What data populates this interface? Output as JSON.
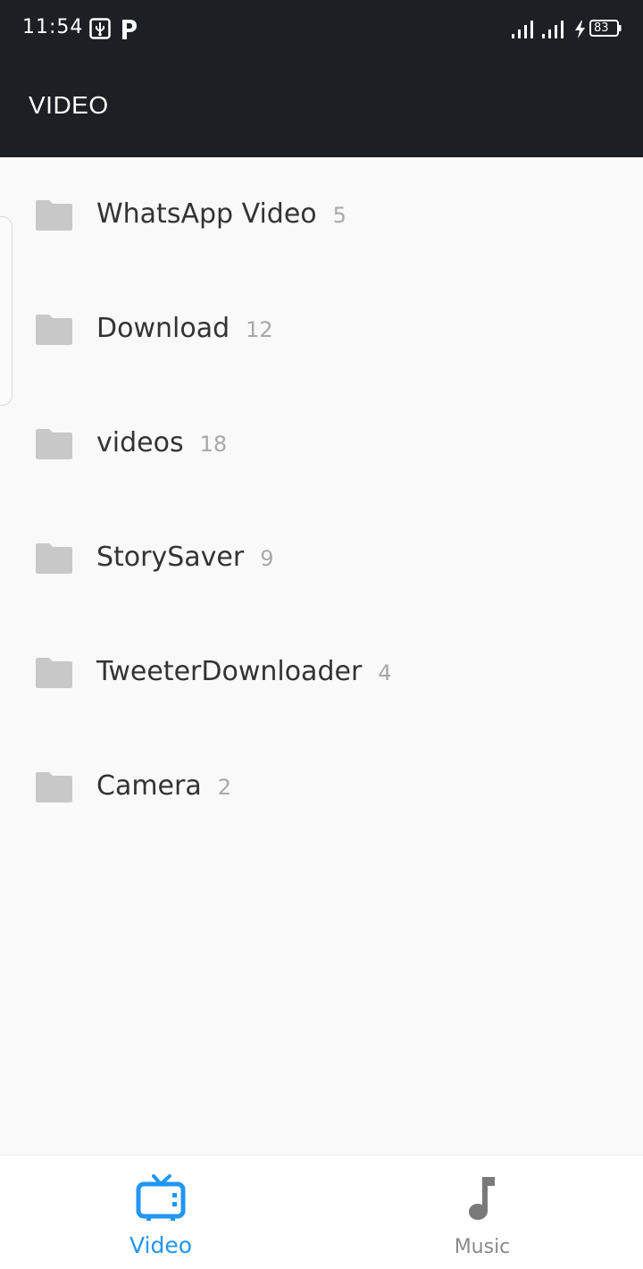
{
  "status_bar": {
    "time": "11:54",
    "battery": "83",
    "icons": [
      "usb-icon",
      "p-app-icon",
      "signal-icon",
      "signal-icon",
      "charging-icon",
      "battery-icon"
    ]
  },
  "app_bar": {
    "title": "VIDEO"
  },
  "folders": [
    {
      "name": "WhatsApp Video",
      "count": "5",
      "icon": "folder-icon"
    },
    {
      "name": "Download",
      "count": "12",
      "icon": "folder-icon"
    },
    {
      "name": "videos",
      "count": "18",
      "icon": "folder-icon"
    },
    {
      "name": "StorySaver",
      "count": "9",
      "icon": "folder-icon"
    },
    {
      "name": "TweeterDownloader",
      "count": "4",
      "icon": "folder-icon"
    },
    {
      "name": "Camera",
      "count": "2",
      "icon": "folder-icon"
    }
  ],
  "bottom_nav": {
    "video": {
      "label": "Video",
      "icon": "tv-icon",
      "selected": true
    },
    "music": {
      "label": "Music",
      "icon": "music-note-icon",
      "selected": false
    }
  },
  "colors": {
    "app_bar_bg": "#1c1f24",
    "background": "#f9f9f9",
    "accent": "#2196f3",
    "folder_icon": "#c8c8c8",
    "count_text": "#a8a8a8",
    "inactive_nav": "#8a8a8a"
  }
}
